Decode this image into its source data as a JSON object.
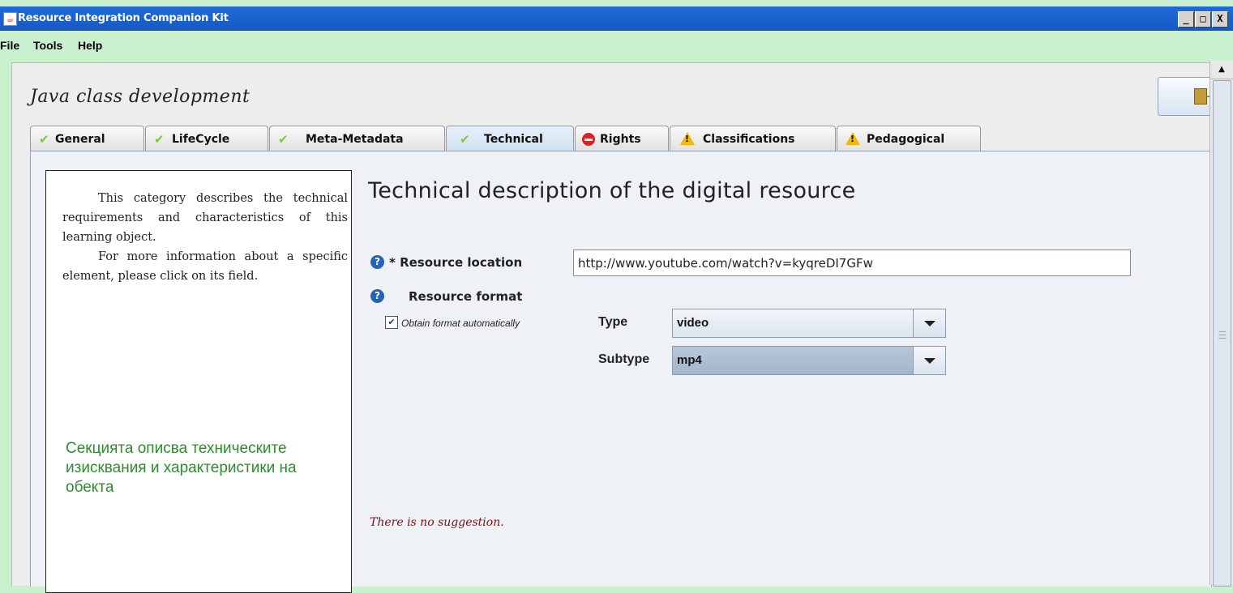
{
  "window": {
    "title": "Resource Integration Companion Kit",
    "buttons": {
      "minimize": "_",
      "maximize": "□",
      "close": "X"
    }
  },
  "menu": {
    "file": "File",
    "tools": "Tools",
    "help": "Help"
  },
  "course_title": "Java class development",
  "tabs": [
    {
      "label": "General",
      "status": "check"
    },
    {
      "label": "LifeCycle",
      "status": "check"
    },
    {
      "label": "Meta-Metadata",
      "status": "check"
    },
    {
      "label": "Technical",
      "status": "check",
      "active": true
    },
    {
      "label": "Rights",
      "status": "stop"
    },
    {
      "label": "Classifications",
      "status": "warning"
    },
    {
      "label": "Pedagogical",
      "status": "warning"
    }
  ],
  "description": {
    "paragraph1": "This category describes the technical requirements and characteristics of this learning object.",
    "paragraph2": "For more information about a specific element, please click on its field.",
    "translation": "Секцията описва техническите изисквания и характеристики на обекта"
  },
  "heading": "Technical description of the digital resource",
  "resource_location": {
    "label": "* Resource location",
    "value": "http://www.youtube.com/watch?v=kyqreDI7GFw"
  },
  "resource_format": {
    "label": "Resource format",
    "auto_label": "Obtain format automatically",
    "auto_checked": true,
    "type_label": "Type",
    "type_value": "video",
    "subtype_label": "Subtype",
    "subtype_value": "mp4"
  },
  "suggestion": "There is no suggestion.",
  "icons": {
    "check": "checkmark-icon",
    "stop": "stop-icon",
    "warning": "warning-icon",
    "help": "help-icon",
    "exit": "exit-icon"
  },
  "colors": {
    "title_bar": "#1658c4",
    "background": "#c9f0cf",
    "check": "#7acb3a",
    "stop": "#e02020",
    "warning": "#f0b800",
    "translation_text": "#2e8b2e",
    "suggestion_text": "#7a1010"
  }
}
